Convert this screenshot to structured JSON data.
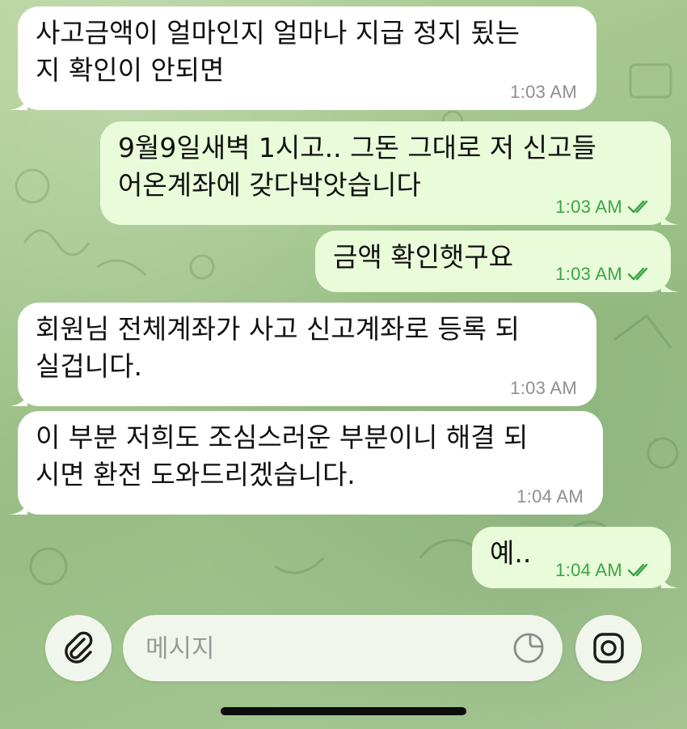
{
  "messages": [
    {
      "direction": "incoming",
      "text": "사고금액이 얼마인지 얼마나 지급 정지 됬는\n지 확인이 안되면",
      "time": "1:03 AM"
    },
    {
      "direction": "outgoing",
      "text": "9월9일새벽 1시고.. 그돈 그대로 저 신고들\n어온계좌에 갖다박앗습니다",
      "time": "1:03 AM",
      "status": "read"
    },
    {
      "direction": "outgoing",
      "text": "금액 확인햇구요",
      "time": "1:03 AM",
      "status": "read"
    },
    {
      "direction": "incoming",
      "text": "회원님 전체계좌가 사고 신고계좌로 등록 되\n실겁니다.",
      "time": "1:03 AM"
    },
    {
      "direction": "incoming",
      "text": "이 부분 저희도 조심스러운 부분이니 해결 되\n시면 환전 도와드리겠습니다.",
      "time": "1:04 AM"
    },
    {
      "direction": "outgoing",
      "text": "예..",
      "time": "1:04 AM",
      "status": "read"
    }
  ],
  "composer": {
    "placeholder": "메시지",
    "attach_icon": "paperclip-icon",
    "sticker_icon": "sticker-icon",
    "camera_icon": "camera-icon"
  },
  "colors": {
    "incoming_bubble": "#ffffff",
    "outgoing_bubble": "#e9fbd8",
    "outgoing_meta": "#3aa548",
    "background": "#a9c894"
  }
}
